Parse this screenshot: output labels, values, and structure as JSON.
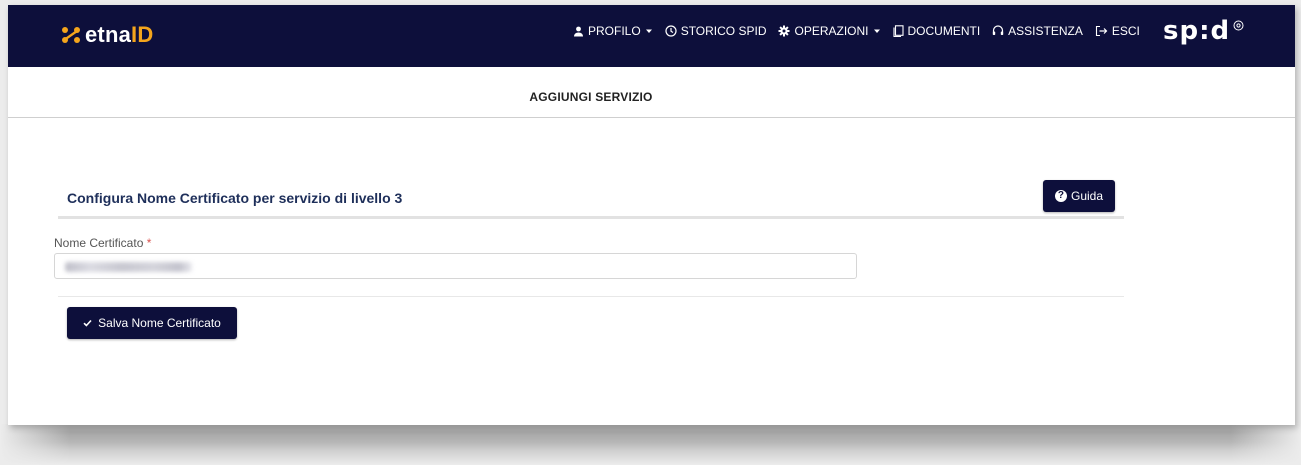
{
  "brand": {
    "logo_part1": "etna",
    "logo_part2": "ID",
    "spid_text": "sp:d",
    "accent_color": "#f4a51c",
    "navbar_color": "#0d0f3b"
  },
  "nav": {
    "items": [
      {
        "label": "PROFILO",
        "icon": "user-icon",
        "dropdown": true
      },
      {
        "label": "STORICO SPID",
        "icon": "clock-icon",
        "dropdown": false
      },
      {
        "label": "OPERAZIONI",
        "icon": "gear-icon",
        "dropdown": true
      },
      {
        "label": "DOCUMENTI",
        "icon": "document-icon",
        "dropdown": false
      },
      {
        "label": "ASSISTENZA",
        "icon": "headset-icon",
        "dropdown": false
      },
      {
        "label": "ESCI",
        "icon": "logout-icon",
        "dropdown": false
      }
    ]
  },
  "page": {
    "heading": "AGGIUNGI SERVIZIO"
  },
  "section": {
    "title": "Configura Nome Certificato per servizio di livello 3",
    "guide_label": "Guida"
  },
  "form": {
    "field_label": "Nome Certificato",
    "required_mark": "*",
    "save_label": "Salva Nome Certificato"
  }
}
